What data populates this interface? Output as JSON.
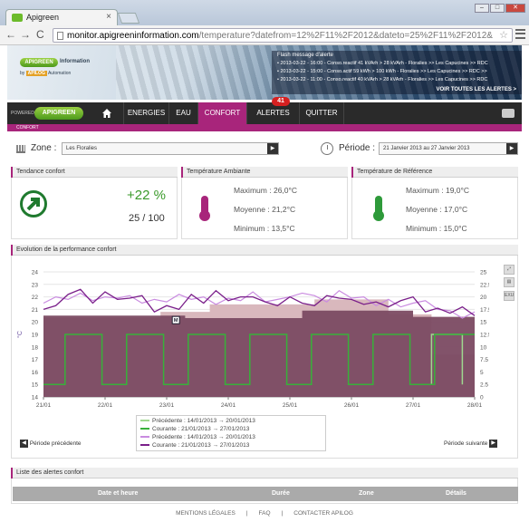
{
  "browser": {
    "tab_title": "Apigreen",
    "tab_close": "×",
    "url_domain": "monitor.apigreeninformation.com",
    "url_path": "/temperature?datefrom=12%2F11%2F2012&dateto=25%2F11%2F2012&compareto=la",
    "back": "←",
    "forward": "→",
    "reload": "C",
    "star": "☆",
    "window_controls": [
      "‒",
      "□",
      "✕"
    ]
  },
  "header": {
    "logo_word1": "APIGREEN",
    "logo_word2": "Information",
    "logo_by": "by",
    "logo_brand": "APILOG",
    "logo_suffix": "Automation",
    "flash_title": "Flash message d'alerte",
    "flash_items": [
      "2013-03-22 - 16:00 - Conso.reactif 41 kVArh > 28 kVArh - Floralies >> Les Capucines >> RDC",
      "2013-03-22 - 15:00 - Conso.actif 59 kWh > 100 kWh - Floralies >> Les Capucines >> RDC >>",
      "2013-03-22 - 11:00 - Conso.reactif 40 kVArh > 28 kVArh - Floralies >> Les Capucines >> RDC"
    ],
    "see_all": "VOIR TOUTES LES ALERTES >"
  },
  "nav": {
    "powered_by": "POWERED BY",
    "apigreen": "APIGREEN",
    "items": [
      "ENERGIES",
      "EAU",
      "CONFORT",
      "ALERTES",
      "QUITTER"
    ],
    "alert_count": "41",
    "breadcrumb": "CONFORT"
  },
  "filters": {
    "zone_label": "Zone",
    "zone_colon": ":",
    "zone_value": "Les Floralies",
    "periode_label": "Période",
    "periode_colon": ":",
    "periode_value": "21 Janvier 2013 au 27 Janvier 2013",
    "arrow": "▶"
  },
  "tendance": {
    "title": "Tendance confort",
    "pct": "+22 %",
    "score": "25 / 100"
  },
  "ambiante": {
    "title": "Température Ambiante",
    "max_label": "Maximum",
    "max_value": "26,0°C",
    "moy_label": "Moyenne",
    "moy_value": "21,2°C",
    "min_label": "Minimum",
    "min_value": "13,5°C",
    "colon": ":"
  },
  "reference": {
    "title": "Température de Référence",
    "max_label": "Maximum",
    "max_value": "19,0°C",
    "moy_label": "Moyenne",
    "moy_value": "17,0°C",
    "min_label": "Minimum",
    "min_value": "15,0°C",
    "colon": ":"
  },
  "chart_section": {
    "title": "Evolution de la performance confort",
    "side_icons": [
      "zoom-icon",
      "print-icon",
      "export-icon"
    ],
    "export_label": "EXU",
    "prev_label": "Période précédente",
    "next_label": "Période suivante",
    "prev_arrow": "◀",
    "next_arrow": "▶",
    "marker_label": "M",
    "colors": {
      "area_prev": "#d9b8bd",
      "area_curr": "#7b4a62",
      "line_prev_green": "#9fd88f",
      "line_curr_green": "#38b13a",
      "line_prev_purple": "#c98be0",
      "line_curr_purple": "#7a1f8a"
    }
  },
  "chart_data": {
    "type": "line",
    "x_ticks": [
      "21/01",
      "22/01",
      "23/01",
      "24/01",
      "25/01",
      "26/01",
      "27/01",
      "28/01"
    ],
    "y_left": {
      "ticks": [
        14,
        15,
        16,
        17,
        18,
        19,
        20,
        21,
        22,
        23,
        24
      ],
      "range": [
        14,
        24
      ],
      "label": "°C"
    },
    "y_right": {
      "ticks": [
        0,
        2.5,
        5,
        7.5,
        10,
        12.5,
        15,
        17.5,
        20,
        22.5,
        25
      ],
      "range": [
        0,
        25
      ],
      "label": "DJU"
    },
    "series": [
      {
        "name": "Précédente : 14/01/2013 → 20/01/2013",
        "role": "reference-area",
        "x": [
          0,
          1.9,
          1.9,
          2.7,
          2.7,
          4.4,
          4.4,
          5.6,
          5.6,
          6.3,
          6.3,
          7.0
        ],
        "y": [
          20.3,
          20.3,
          20.8,
          20.8,
          21.4,
          21.4,
          21.8,
          21.8,
          20.6,
          20.6,
          17.4,
          17.4
        ]
      },
      {
        "name": "Courante : 21/01/2013 → 27/01/2013",
        "role": "reference-area",
        "x": [
          0,
          2.3,
          2.3,
          4.2,
          4.2,
          6.0,
          6.0,
          7.0
        ],
        "y": [
          20.5,
          20.5,
          20.3,
          20.3,
          20.9,
          20.9,
          20.4,
          20.4
        ]
      },
      {
        "name": "Précédente : 14/01/2013 → 20/01/2013",
        "role": "reference-temp",
        "x": [
          6.3,
          6.3,
          6.8,
          6.8
        ],
        "y": [
          15,
          19,
          19,
          15
        ]
      },
      {
        "name": "Courante : 21/01/2013 → 27/01/2013",
        "role": "reference-temp",
        "x": [
          0,
          0.35,
          0.35,
          0.95,
          0.95,
          1.35,
          1.35,
          1.95,
          1.95,
          2.35,
          2.35,
          2.95,
          2.95,
          3.35,
          3.35,
          3.95,
          3.95,
          4.35,
          4.35,
          4.95,
          4.95,
          5.35,
          5.35,
          5.95,
          5.95,
          6.35,
          6.35,
          7.0
        ],
        "y": [
          15,
          15,
          19,
          19,
          15,
          15,
          19,
          19,
          15,
          15,
          19,
          19,
          15,
          15,
          19,
          19,
          15,
          15,
          19,
          19,
          15,
          15,
          19,
          19,
          15,
          15,
          19,
          19
        ]
      },
      {
        "name": "Précédente : 14/01/2013 → 20/01/2013",
        "role": "ambient-temp",
        "x": [
          0,
          0.2,
          0.4,
          0.6,
          0.8,
          1.0,
          1.2,
          1.4,
          1.6,
          1.8,
          2.0,
          2.2,
          2.4,
          2.6,
          2.8,
          3.0,
          3.2,
          3.4,
          3.6,
          3.8,
          4.0,
          4.2,
          4.4,
          4.6,
          4.8,
          5.0,
          5.2,
          5.4,
          5.6,
          5.8,
          6.0,
          6.2,
          6.4,
          6.6,
          6.8,
          7.0
        ],
        "y": [
          21.5,
          22.0,
          21.8,
          22.3,
          21.7,
          22.0,
          21.9,
          22.1,
          21.5,
          21.8,
          21.6,
          22.2,
          21.8,
          22.0,
          21.4,
          21.9,
          21.7,
          22.4,
          21.6,
          21.8,
          22.0,
          22.3,
          22.1,
          21.6,
          22.5,
          21.9,
          22.0,
          21.3,
          21.8,
          21.2,
          21.5,
          21.7,
          21.0,
          20.9,
          20.3,
          20.8
        ]
      },
      {
        "name": "Courante : 21/01/2013 → 27/01/2013",
        "role": "ambient-temp",
        "x": [
          0,
          0.2,
          0.4,
          0.6,
          0.8,
          1.0,
          1.2,
          1.4,
          1.6,
          1.8,
          2.0,
          2.2,
          2.4,
          2.6,
          2.8,
          3.0,
          3.2,
          3.4,
          3.6,
          3.8,
          4.0,
          4.2,
          4.4,
          4.6,
          4.8,
          5.0,
          5.2,
          5.4,
          5.6,
          5.8,
          6.0,
          6.2,
          6.4,
          6.6,
          6.8,
          7.0
        ],
        "y": [
          21.0,
          21.3,
          22.2,
          22.6,
          21.5,
          22.4,
          21.8,
          21.9,
          22.1,
          20.8,
          21.3,
          21.0,
          22.2,
          21.5,
          22.5,
          21.7,
          22.0,
          22.0,
          21.6,
          21.3,
          22.0,
          21.5,
          21.3,
          22.1,
          21.9,
          21.8,
          21.4,
          21.6,
          21.2,
          21.7,
          22.0,
          20.8,
          21.1,
          20.7,
          21.2,
          20.5
        ]
      }
    ]
  },
  "alerts_list": {
    "title": "Liste des alertes confort",
    "columns": [
      "Date et heure",
      "Durée",
      "Zone",
      "Détails"
    ]
  },
  "footer": {
    "links": [
      "MENTIONS LÉGALES",
      "FAQ",
      "CONTACTER APILOG"
    ],
    "separator": "|"
  }
}
